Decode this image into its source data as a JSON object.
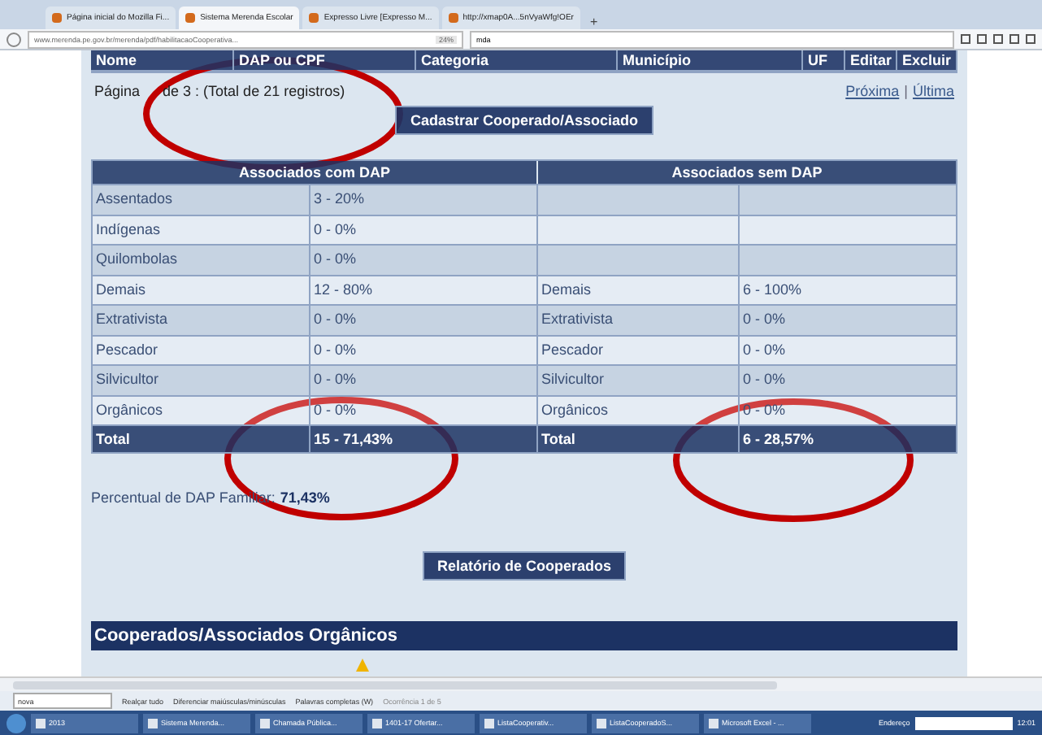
{
  "browser": {
    "tabs": [
      {
        "label": "Página inicial do Mozilla Fi...",
        "selected": false
      },
      {
        "label": "Sistema Merenda Escolar",
        "selected": true
      },
      {
        "label": "Expresso Livre [Expresso M...",
        "selected": false
      },
      {
        "label": "http://xmap0A...5nVyaWfg!OEr",
        "selected": false
      }
    ],
    "new_tab": "+",
    "url": "www.merenda.pe.gov.br/merenda/pdf/habilitacaoCooperativa...",
    "zoom": "24%",
    "search": "mda"
  },
  "list_columns": [
    "Nome",
    "DAP ou CPF",
    "Categoria",
    "Município",
    "UF",
    "Editar",
    "Excluir"
  ],
  "pagination": {
    "prefix": "Página",
    "text": "de 3 : (Total de 21 registros)",
    "links": [
      "Próxima",
      "Última"
    ],
    "separator": "|"
  },
  "register_button": "Cadastrar Cooperado/Associado",
  "summary": {
    "headers": [
      "Associados com DAP",
      "Associados sem DAP"
    ],
    "rows": [
      [
        "Assentados",
        "3 - 20%",
        "",
        ""
      ],
      [
        "Indígenas",
        "0 - 0%",
        "",
        ""
      ],
      [
        "Quilombolas",
        "0 - 0%",
        "",
        ""
      ],
      [
        "Demais",
        "12 - 80%",
        "Demais",
        "6 - 100%"
      ],
      [
        "Extrativista",
        "0 - 0%",
        "Extrativista",
        "0 - 0%"
      ],
      [
        "Pescador",
        "0 - 0%",
        "Pescador",
        "0 - 0%"
      ],
      [
        "Silvicultor",
        "0 - 0%",
        "Silvicultor",
        "0 - 0%"
      ],
      [
        "Orgânicos",
        "0 - 0%",
        "Orgânicos",
        "0 - 0%"
      ]
    ],
    "total": [
      "Total",
      "15 - 71,43%",
      "Total",
      "6 - 28,57%"
    ]
  },
  "dap_percent": {
    "label": "Percentual de DAP Familiar:",
    "value": "71,43%"
  },
  "report_button": "Relatório de Cooperados",
  "section_title": "Cooperados/Associados Orgânicos",
  "find_bar": {
    "value": "nova",
    "options": [
      "Realçar tudo",
      "Diferenciar maiúsculas/minúsculas",
      "Palavras completas (W)"
    ],
    "status": "Ocorrência 1 de 5"
  },
  "taskbar": {
    "items": [
      "2013",
      "Sistema Merenda...",
      "Chamada Pública...",
      "1401-17 Ofertar...",
      "ListaCooperativ...",
      "ListaCooperadoS...",
      "Microsoft Excel - ..."
    ],
    "address_label": "Endereço",
    "time": "12:01"
  }
}
